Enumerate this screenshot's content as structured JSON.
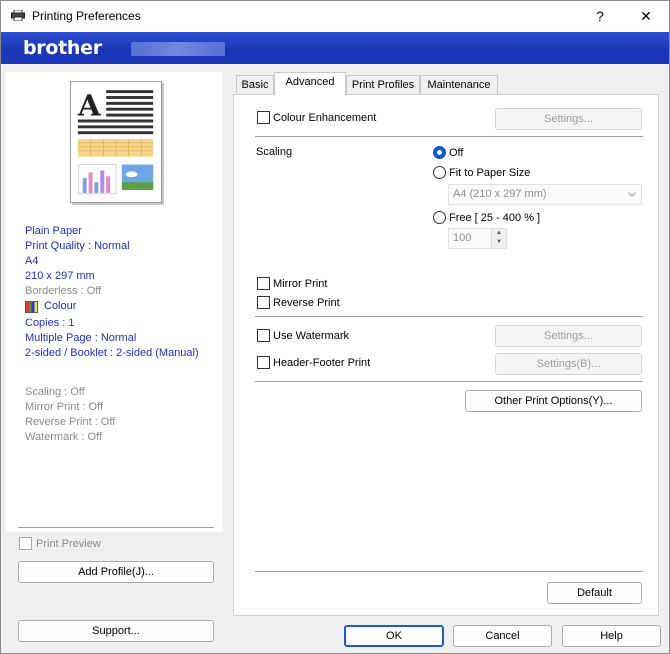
{
  "window": {
    "title": "Printing Preferences",
    "help_glyph": "?",
    "close_glyph": "✕",
    "brand": "brother"
  },
  "summary": {
    "paper": "Plain Paper",
    "quality": "Print Quality : Normal",
    "size": "A4",
    "dimensions": "210 x 297 mm",
    "borderless": "Borderless : Off",
    "colour": "Colour",
    "copies": "Copies : 1",
    "multiple_page": "Multiple Page : Normal",
    "two_sided": "2-sided / Booklet : 2-sided (Manual)",
    "scaling": "Scaling : Off",
    "mirror": "Mirror Print : Off",
    "reverse": "Reverse Print : Off",
    "watermark": "Watermark : Off"
  },
  "left": {
    "print_preview": "Print Preview",
    "add_profile": "Add Profile(J)...",
    "support": "Support..."
  },
  "tabs": [
    {
      "label": "Basic",
      "active": false
    },
    {
      "label": "Advanced",
      "active": true
    },
    {
      "label": "Print Profiles",
      "active": false
    },
    {
      "label": "Maintenance",
      "active": false
    }
  ],
  "advanced": {
    "colour_enhancement": "Colour Enhancement",
    "colour_settings": "Settings...",
    "scaling_label": "Scaling",
    "scaling_off": "Off",
    "fit_to_paper": "Fit to Paper Size",
    "paper_size_value": "A4 (210 x 297 mm)",
    "free": "Free [ 25 - 400 % ]",
    "free_value": "100",
    "mirror_print": "Mirror Print",
    "reverse_print": "Reverse Print",
    "use_watermark": "Use Watermark",
    "watermark_settings": "Settings...",
    "header_footer": "Header-Footer Print",
    "header_footer_settings": "Settings(B)...",
    "other_options": "Other Print Options(Y)...",
    "default": "Default"
  },
  "footer": {
    "ok": "OK",
    "cancel": "Cancel",
    "help": "Help"
  },
  "colors": {
    "banner": "#1a35b4",
    "accent": "#0a59c8",
    "summary_text": "#1f2fbf"
  }
}
